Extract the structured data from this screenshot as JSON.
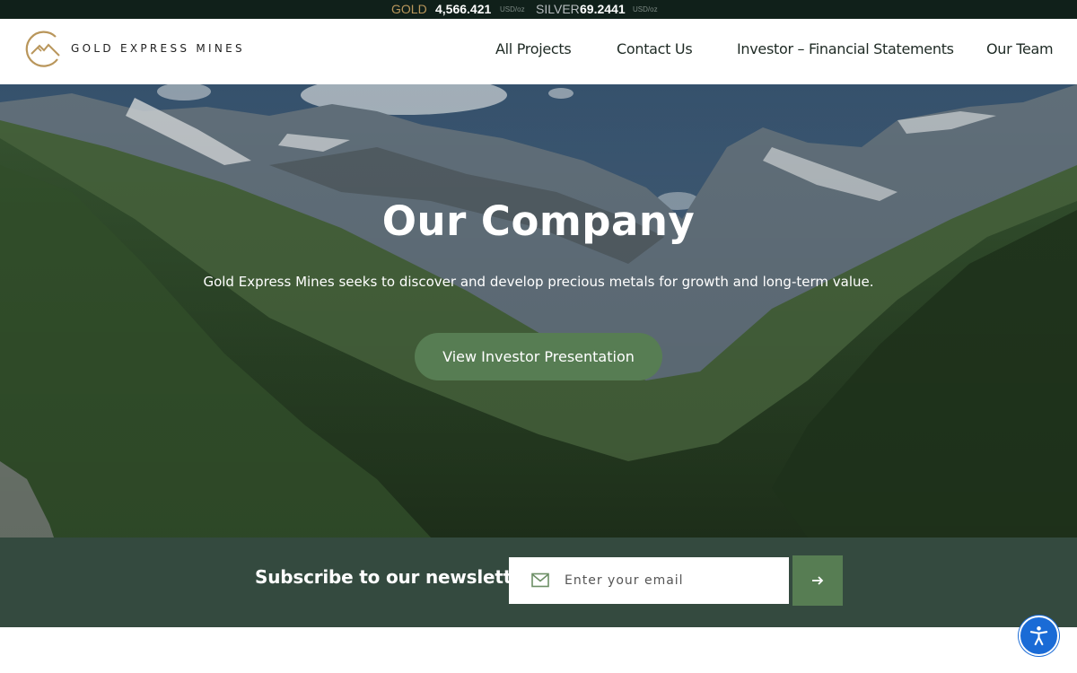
{
  "ticker": {
    "gold_label": "GOLD",
    "gold_price": "4,566.421",
    "gold_unit": "USD/oz",
    "silver_label": "SILVER",
    "silver_price": "69.2441",
    "silver_unit": "USD/oz"
  },
  "header": {
    "logo_text": "GOLD EXPRESS MINES",
    "logo_icon": "mountain-circle-logo",
    "nav": [
      {
        "label": "All Projects"
      },
      {
        "label": "Contact Us"
      },
      {
        "label": "Investor – Financial Statements"
      },
      {
        "label": "Our Team"
      }
    ]
  },
  "hero": {
    "title": "Our Company",
    "subtitle": "Gold Express Mines seeks to discover and develop precious metals for growth and long-term value.",
    "button_label": "View Investor Presentation"
  },
  "newsletter": {
    "title": "Subscribe to our newsletter",
    "email_placeholder": "Enter your email",
    "email_icon": "envelope-icon",
    "submit_icon": "arrow-right-icon"
  },
  "accessibility": {
    "icon": "accessibility-icon"
  },
  "colors": {
    "ticker_bg": "#10201a",
    "gold": "#b9965b",
    "accent_green": "#577d53",
    "newsletter_bg": "#344a3f",
    "a11y_blue": "#1a6bd6"
  }
}
